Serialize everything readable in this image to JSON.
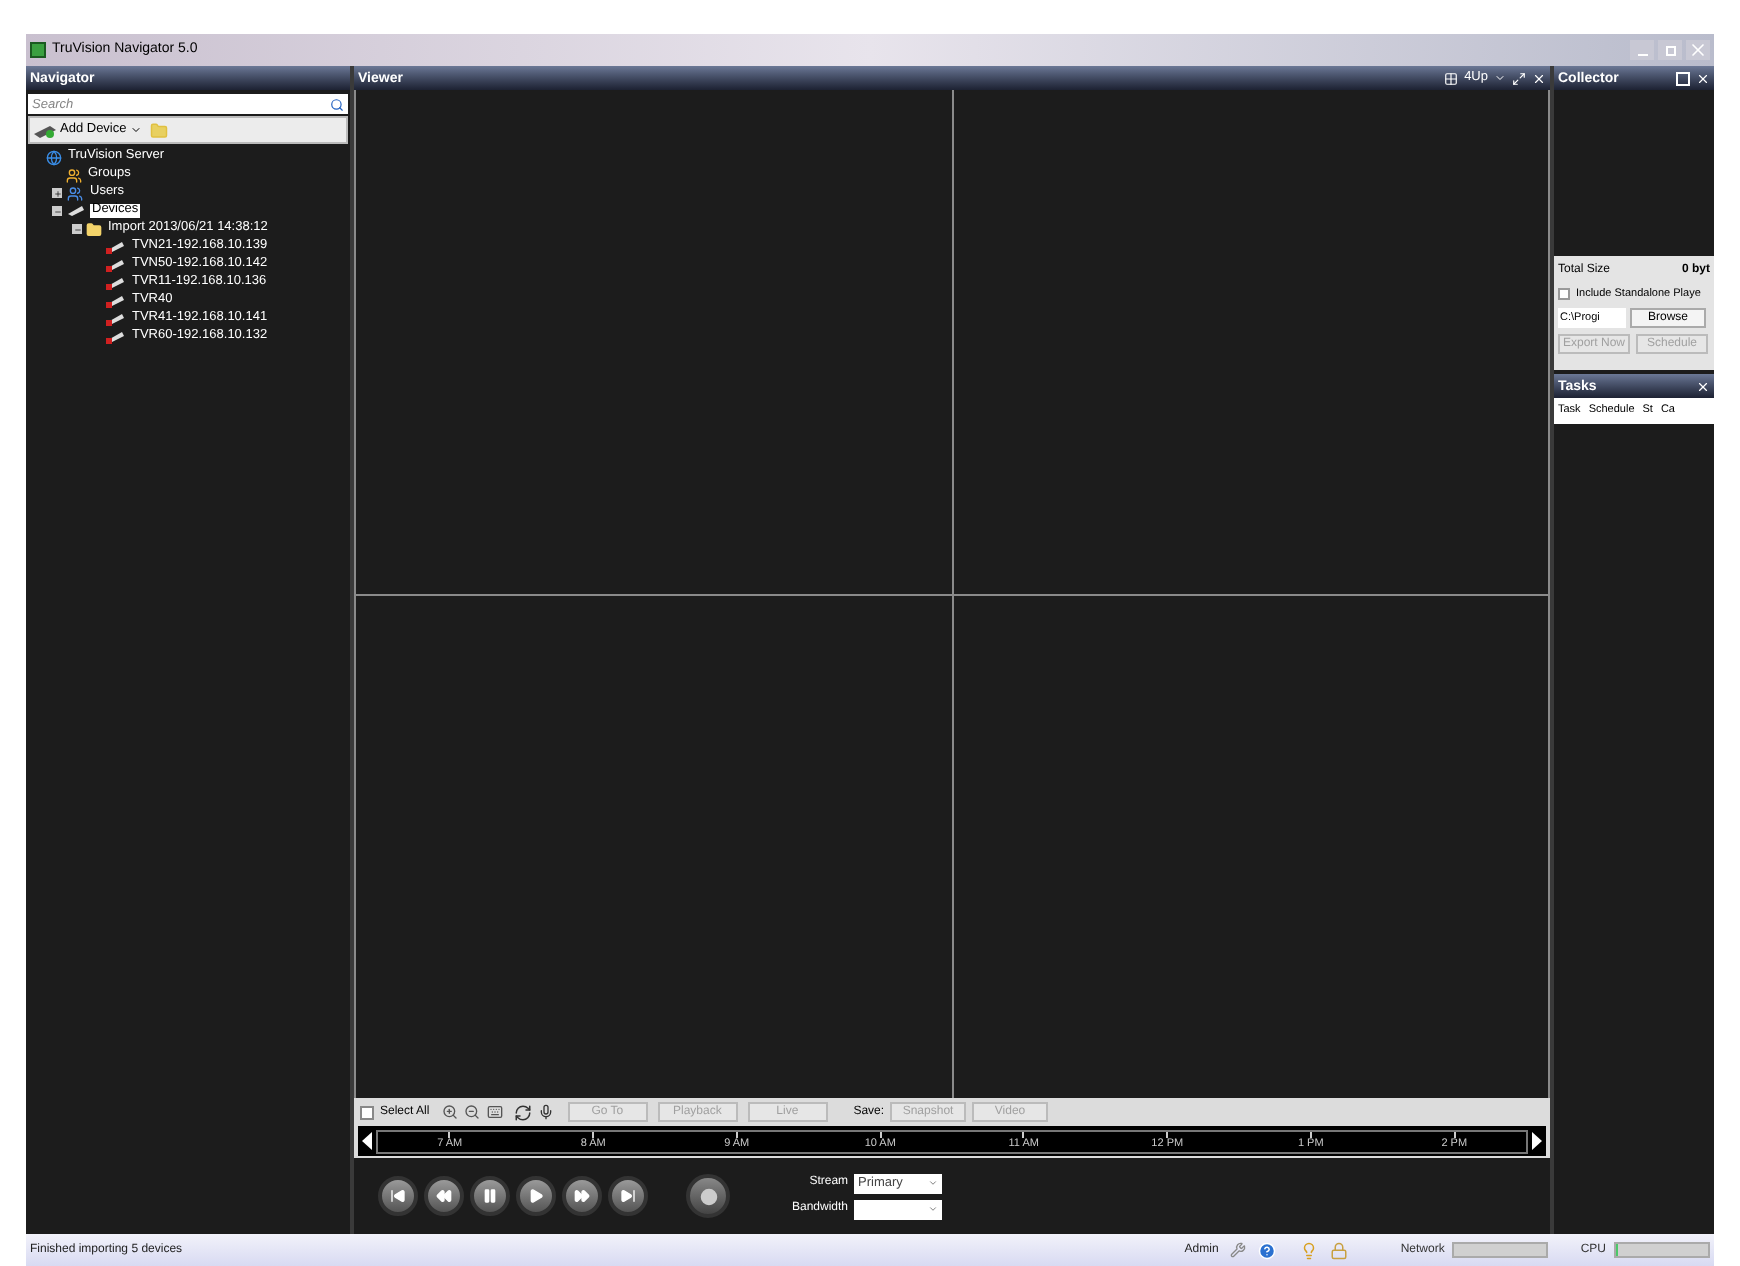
{
  "window": {
    "title": "TruVision Navigator 5.0"
  },
  "navigator": {
    "title": "Navigator",
    "search": {
      "placeholder": "Search"
    },
    "add_device": "Add Device",
    "tree": [
      {
        "label": "TruVision Server",
        "kind": "server",
        "selected": false,
        "children": [
          {
            "label": "Groups",
            "kind": "groups",
            "selected": false
          },
          {
            "label": "Users",
            "kind": "users",
            "expanded": false,
            "selected": false
          },
          {
            "label": "Devices",
            "kind": "devices",
            "expanded": true,
            "selected": true,
            "children": [
              {
                "label": "Import 2013/06/21 14:38:12",
                "kind": "folder",
                "expanded": true,
                "selected": false,
                "children": [
                  {
                    "label": "TVN21-192.168.10.139",
                    "kind": "device",
                    "selected": false
                  },
                  {
                    "label": "TVN50-192.168.10.142",
                    "kind": "device",
                    "selected": false
                  },
                  {
                    "label": "TVR11-192.168.10.136",
                    "kind": "device",
                    "selected": false
                  },
                  {
                    "label": "TVR40",
                    "kind": "device",
                    "selected": false
                  },
                  {
                    "label": "TVR41-192.168.10.141",
                    "kind": "device",
                    "selected": false
                  },
                  {
                    "label": "TVR60-192.168.10.132",
                    "kind": "device",
                    "selected": false
                  }
                ]
              }
            ]
          }
        ]
      }
    ]
  },
  "viewer": {
    "title": "Viewer",
    "layout": "4Up",
    "toolbar": {
      "select_all": {
        "label": "Select All",
        "checked": false
      },
      "buttons": [
        {
          "label": "Go To",
          "disabled": true
        },
        {
          "label": "Playback",
          "disabled": true
        },
        {
          "label": "Live",
          "disabled": true
        }
      ],
      "save_label": "Save:",
      "save_buttons": [
        {
          "label": "Snapshot",
          "disabled": true
        },
        {
          "label": "Video",
          "disabled": true
        }
      ]
    },
    "timeline": [
      "7 AM",
      "8 AM",
      "9 AM",
      "10 AM",
      "11 AM",
      "12 PM",
      "1 PM",
      "2 PM"
    ],
    "stream": {
      "label": "Stream",
      "value": "Primary"
    },
    "bandwidth": {
      "label": "Bandwidth"
    }
  },
  "collector": {
    "title": "Collector",
    "total_size_label": "Total Size",
    "total_size": "0 byt",
    "standalone": {
      "label": "Include Standalone Playe",
      "checked": false
    },
    "path": "C:\\Progi",
    "browse": "Browse",
    "buttons": [
      {
        "label": "Export Now",
        "disabled": true
      },
      {
        "label": "Schedule",
        "disabled": true
      }
    ]
  },
  "tasks": {
    "title": "Tasks",
    "columns": [
      "Task",
      "Schedule",
      "St",
      "Ca"
    ]
  },
  "status_bar": {
    "message": "Finished importing 5 devices",
    "user": "Admin",
    "network": {
      "label": "Network"
    },
    "cpu": {
      "label": "CPU",
      "level": 0.03
    }
  }
}
